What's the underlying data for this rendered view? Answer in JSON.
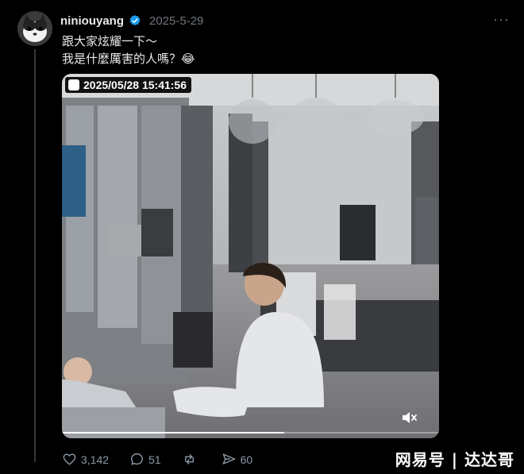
{
  "post": {
    "username": "niniouyang",
    "date": "2025-5-29",
    "text_line1": "跟大家炫耀一下～",
    "text_line2": "我是什麼厲害的人嗎？😂",
    "more_label": "···"
  },
  "media": {
    "camera_timestamp": "2025/05/28 15:41:56",
    "progress": 0.59
  },
  "actions": {
    "likes": "3,142",
    "replies": "51",
    "reposts": "",
    "shares": "60"
  },
  "watermark": "网易号 | 达达哥",
  "colors": {
    "background": "#000000",
    "text": "#e7e9ea",
    "muted": "#71767b",
    "verified": "#1d9bf0"
  }
}
